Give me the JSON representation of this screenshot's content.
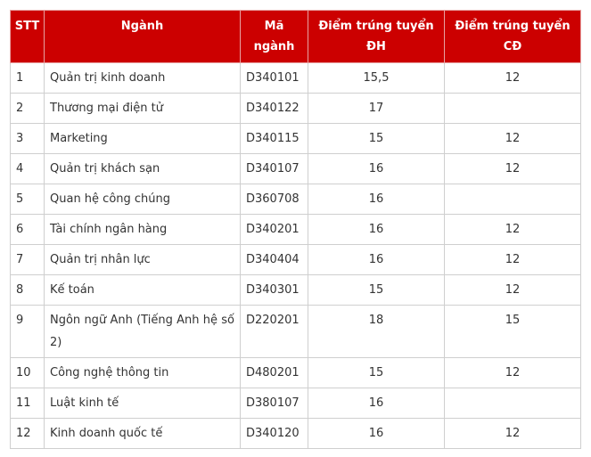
{
  "table": {
    "headers": {
      "stt": "STT",
      "nganh": "Ngành",
      "ma_nganh_line1": "Mã",
      "ma_nganh_line2": "ngành",
      "diem_dh_line1": "Điểm trúng tuyển",
      "diem_dh_line2": "ĐH",
      "diem_cd_line1": "Điểm trúng tuyển",
      "diem_cd_line2": "CĐ"
    },
    "rows": [
      {
        "stt": "1",
        "nganh": "Quản trị kinh doanh",
        "ma": "D340101",
        "dh": "15,5",
        "cd": "12"
      },
      {
        "stt": "2",
        "nganh": "Thương mại điện tử",
        "ma": "D340122",
        "dh": "17",
        "cd": ""
      },
      {
        "stt": "3",
        "nganh": "Marketing",
        "ma": "D340115",
        "dh": "15",
        "cd": "12"
      },
      {
        "stt": "4",
        "nganh": "Quản trị khách sạn",
        "ma": "D340107",
        "dh": "16",
        "cd": "12"
      },
      {
        "stt": "5",
        "nganh": "Quan hệ công chúng",
        "ma": "D360708",
        "dh": "16",
        "cd": ""
      },
      {
        "stt": "6",
        "nganh": "Tài chính ngân hàng",
        "ma": "D340201",
        "dh": "16",
        "cd": "12"
      },
      {
        "stt": "7",
        "nganh": "Quản trị nhân lực",
        "ma": "D340404",
        "dh": "16",
        "cd": "12"
      },
      {
        "stt": "8",
        "nganh": "Kế toán",
        "ma": "D340301",
        "dh": "15",
        "cd": "12"
      },
      {
        "stt": "9",
        "nganh": "Ngôn ngữ Anh (Tiếng Anh hệ số 2)",
        "ma": "D220201",
        "dh": "18",
        "cd": "15"
      },
      {
        "stt": "10",
        "nganh": " Công nghệ thông tin",
        "ma": "D480201",
        "dh": "15",
        "cd": "12"
      },
      {
        "stt": "11",
        "nganh": "Luật kinh tế",
        "ma": "D380107",
        "dh": "16",
        "cd": ""
      },
      {
        "stt": "12",
        "nganh": "Kinh doanh quốc tế",
        "ma": "D340120",
        "dh": "16",
        "cd": "12"
      }
    ]
  },
  "colors": {
    "header_bg": "#cc0000",
    "header_text": "#ffffff",
    "body_text": "#333333",
    "border": "#cfcfcf"
  }
}
